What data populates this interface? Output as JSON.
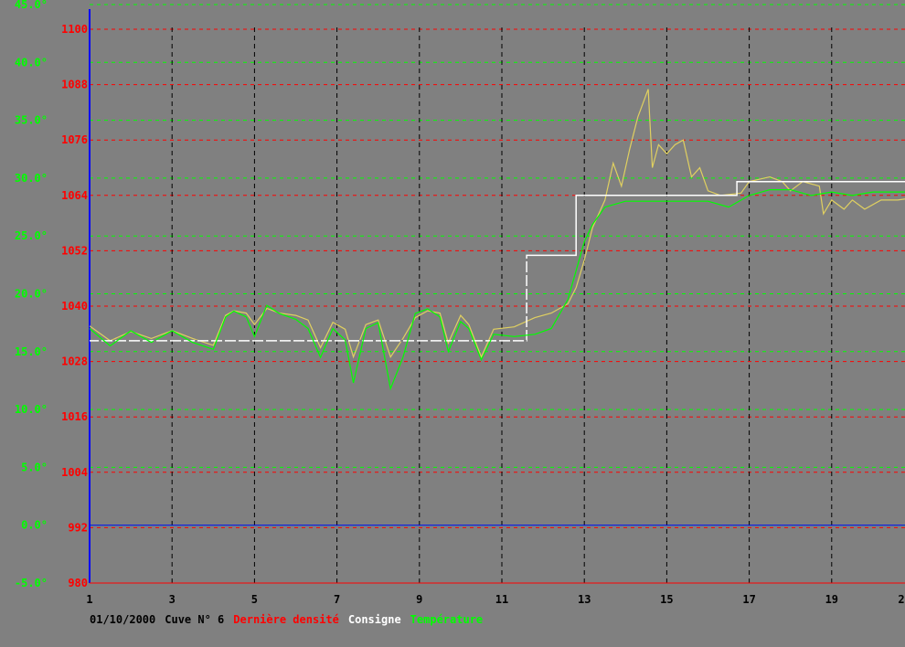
{
  "chart_data": {
    "type": "line",
    "caption_date": "01/10/2000",
    "caption_tank": "Cuve N° 6",
    "x_ticks": [
      "1",
      "3",
      "5",
      "7",
      "9",
      "11",
      "13",
      "15",
      "17",
      "19",
      "2"
    ],
    "xlim": [
      1,
      21
    ],
    "temp_ticks": [
      "45.0°",
      "40.0°",
      "35.0°",
      "30.0°",
      "25.0°",
      "20.0°",
      "15.0°",
      "10.0°",
      "5.0°",
      "0.0°",
      "-5.0°"
    ],
    "temp_lim": [
      -5,
      45
    ],
    "density_ticks": [
      "1100",
      "1088",
      "1076",
      "1064",
      "1052",
      "1040",
      "1028",
      "1016",
      "1004",
      "992",
      "980"
    ],
    "density_lim": [
      980,
      1100
    ],
    "colors": {
      "background": "#808080",
      "density_axis": "#ff0000",
      "temperature_axis": "#00ff00",
      "density_line": "#e0d060",
      "consigne_line": "#ffffff",
      "temperature_line": "#00ff00",
      "y_axis": "#0000ff",
      "x_tick_labels": "#000000"
    },
    "series": [
      {
        "name": "Dernière densité",
        "color": "#e0d060",
        "axis": "density",
        "points": [
          [
            1,
            1035.7
          ],
          [
            1.5,
            1032.5
          ],
          [
            2,
            1034.5
          ],
          [
            2.5,
            1033
          ],
          [
            3,
            1034.7
          ],
          [
            3.5,
            1033
          ],
          [
            4,
            1031.5
          ],
          [
            4.3,
            1038
          ],
          [
            4.5,
            1039
          ],
          [
            4.8,
            1038.5
          ],
          [
            5,
            1036
          ],
          [
            5.3,
            1039.5
          ],
          [
            5.6,
            1038.5
          ],
          [
            6,
            1038
          ],
          [
            6.3,
            1037
          ],
          [
            6.6,
            1031
          ],
          [
            6.9,
            1036.5
          ],
          [
            7.2,
            1035
          ],
          [
            7.4,
            1029
          ],
          [
            7.7,
            1036
          ],
          [
            8,
            1037
          ],
          [
            8.3,
            1029
          ],
          [
            8.6,
            1033
          ],
          [
            8.9,
            1037.5
          ],
          [
            9.2,
            1039
          ],
          [
            9.5,
            1038.5
          ],
          [
            9.7,
            1032
          ],
          [
            10,
            1038
          ],
          [
            10.2,
            1036
          ],
          [
            10.5,
            1029
          ],
          [
            10.8,
            1035
          ],
          [
            11.3,
            1035.5
          ],
          [
            11.8,
            1037.5
          ],
          [
            12.2,
            1038.5
          ],
          [
            12.6,
            1040.5
          ],
          [
            12.8,
            1044
          ],
          [
            13,
            1050
          ],
          [
            13.2,
            1057
          ],
          [
            13.5,
            1063
          ],
          [
            13.7,
            1071
          ],
          [
            13.9,
            1066
          ],
          [
            14.1,
            1074
          ],
          [
            14.3,
            1081
          ],
          [
            14.55,
            1087
          ],
          [
            14.65,
            1070
          ],
          [
            14.8,
            1075
          ],
          [
            15,
            1073
          ],
          [
            15.2,
            1075
          ],
          [
            15.4,
            1076
          ],
          [
            15.6,
            1068
          ],
          [
            15.8,
            1070
          ],
          [
            16,
            1065
          ],
          [
            16.3,
            1064
          ],
          [
            16.8,
            1064.5
          ],
          [
            17,
            1067
          ],
          [
            17.5,
            1068
          ],
          [
            17.8,
            1067
          ],
          [
            18,
            1065
          ],
          [
            18.3,
            1067
          ],
          [
            18.7,
            1066
          ],
          [
            18.8,
            1060
          ],
          [
            19,
            1063
          ],
          [
            19.3,
            1061
          ],
          [
            19.5,
            1063
          ],
          [
            19.8,
            1061
          ],
          [
            20.2,
            1063
          ],
          [
            20.6,
            1063
          ],
          [
            21,
            1063.5
          ]
        ]
      },
      {
        "name": "Consigne",
        "color": "#ffffff",
        "axis": "density",
        "points": [
          [
            1,
            1032.5
          ],
          [
            11.6,
            1032.5
          ],
          [
            11.6,
            1051
          ],
          [
            12.8,
            1051
          ],
          [
            12.8,
            1064
          ],
          [
            16.7,
            1064
          ],
          [
            16.7,
            1067
          ],
          [
            21,
            1067
          ]
        ]
      },
      {
        "name": "Température",
        "color": "#00ff00",
        "axis": "temperature",
        "points": [
          [
            1,
            17
          ],
          [
            1.5,
            15.5
          ],
          [
            2,
            16.8
          ],
          [
            2.5,
            15.8
          ],
          [
            3,
            16.8
          ],
          [
            3.5,
            15.8
          ],
          [
            4,
            15.2
          ],
          [
            4.3,
            18
          ],
          [
            4.5,
            18.5
          ],
          [
            4.8,
            18
          ],
          [
            5,
            16.3
          ],
          [
            5.3,
            19
          ],
          [
            5.6,
            18.3
          ],
          [
            6,
            17.8
          ],
          [
            6.3,
            17
          ],
          [
            6.6,
            14.5
          ],
          [
            6.9,
            17
          ],
          [
            7.2,
            16
          ],
          [
            7.4,
            12.3
          ],
          [
            7.7,
            17
          ],
          [
            8,
            17.5
          ],
          [
            8.3,
            11.8
          ],
          [
            8.6,
            14.5
          ],
          [
            8.9,
            18.3
          ],
          [
            9.2,
            18.7
          ],
          [
            9.5,
            18
          ],
          [
            9.7,
            15
          ],
          [
            10,
            17.6
          ],
          [
            10.2,
            17
          ],
          [
            10.5,
            14.3
          ],
          [
            10.8,
            16.5
          ],
          [
            11.3,
            16.3
          ],
          [
            11.8,
            16.5
          ],
          [
            12.2,
            17
          ],
          [
            12.6,
            19.5
          ],
          [
            12.8,
            22
          ],
          [
            13,
            24.5
          ],
          [
            13.2,
            26
          ],
          [
            13.5,
            27.5
          ],
          [
            14,
            28
          ],
          [
            14.5,
            28
          ],
          [
            15,
            28
          ],
          [
            16,
            28
          ],
          [
            16.5,
            27.5
          ],
          [
            17,
            28.5
          ],
          [
            17.5,
            29
          ],
          [
            18,
            29
          ],
          [
            18.5,
            28.5
          ],
          [
            19,
            28.8
          ],
          [
            19.5,
            28.5
          ],
          [
            20,
            28.8
          ],
          [
            21,
            28.8
          ]
        ]
      }
    ]
  }
}
